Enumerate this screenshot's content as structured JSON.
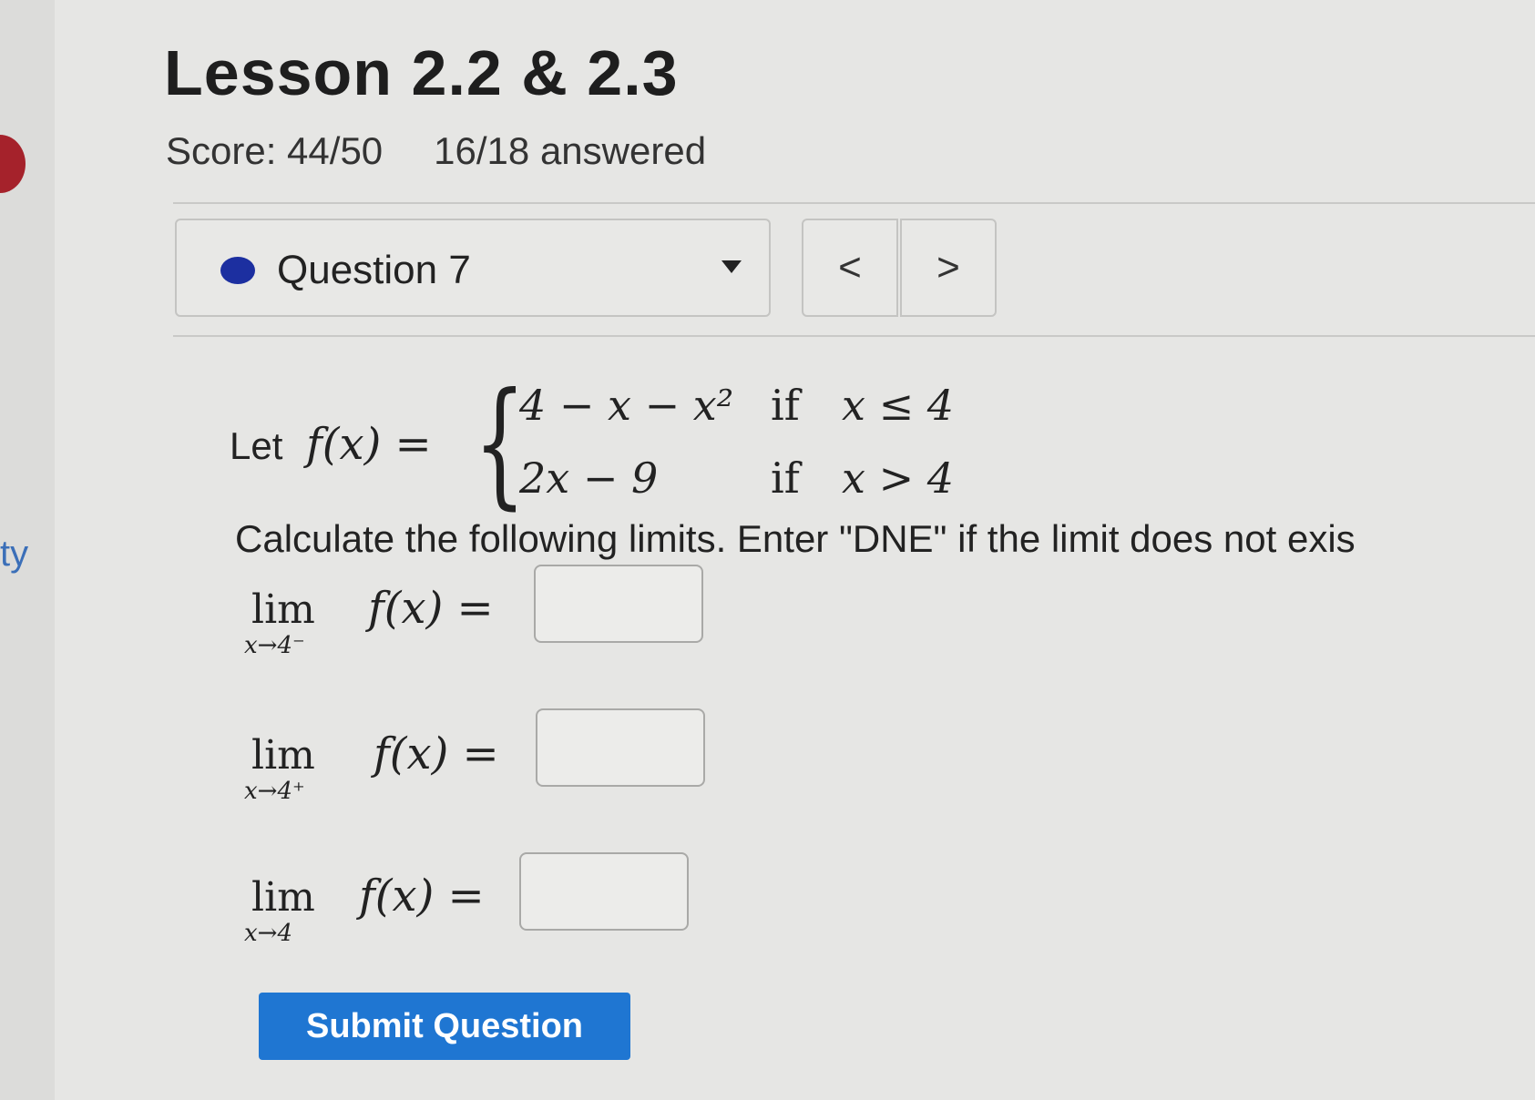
{
  "lesson": {
    "title": "Lesson 2.2 & 2.3",
    "score": "Score: 44/50",
    "answered": "16/18 answered"
  },
  "sidebar": {
    "partial_text": "ty"
  },
  "question_selector": {
    "label": "Question 7",
    "status_color": "#1c2fa0",
    "prev_label": "<",
    "next_label": ">"
  },
  "problem": {
    "let_word": "Let",
    "function_lhs": "f(x) =",
    "cases": [
      {
        "expr": "4 − x − x²",
        "if_word": "if",
        "condition": "x ≤ 4"
      },
      {
        "expr": "2x − 9",
        "if_word": "if",
        "condition": "x > 4"
      }
    ],
    "instructions": "Calculate the following limits. Enter \"DNE\" if the limit does not exis"
  },
  "limits": [
    {
      "lim_word": "lim",
      "subscript": "x→4⁻",
      "expr": "f(x) =",
      "value": ""
    },
    {
      "lim_word": "lim",
      "subscript": "x→4⁺",
      "expr": "f(x) =",
      "value": ""
    },
    {
      "lim_word": "lim",
      "subscript": "x→4",
      "expr": "f(x) =",
      "value": ""
    }
  ],
  "submit": {
    "label": "Submit Question",
    "color": "#1f76d2"
  }
}
